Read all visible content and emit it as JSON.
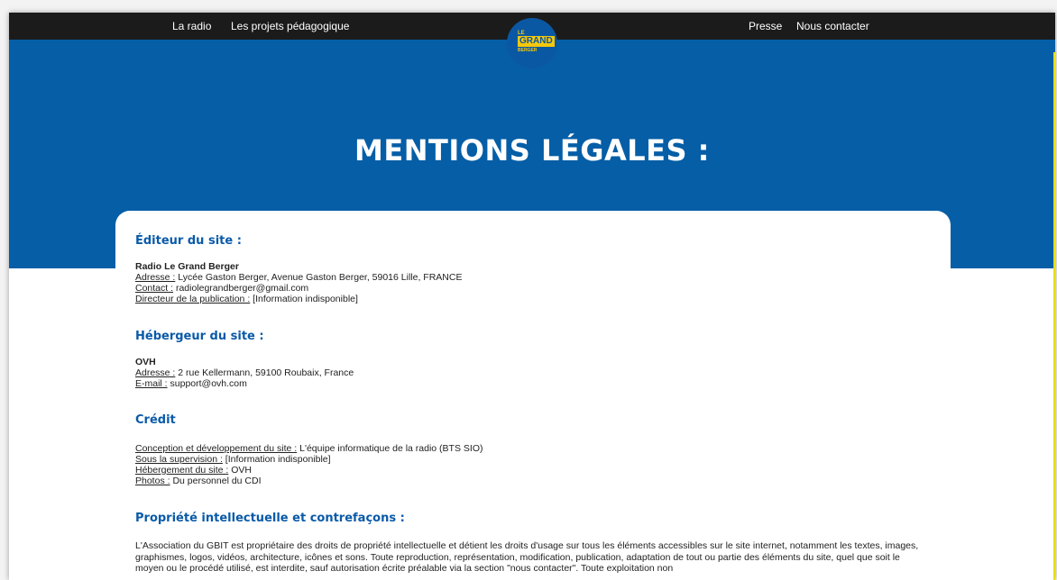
{
  "nav": {
    "left": [
      "La radio",
      "Les projets pédagogique"
    ],
    "right": [
      "Presse",
      "Nous contacter"
    ]
  },
  "logo": {
    "top": "LE",
    "main": "GRAND",
    "bottom": "BERGER",
    "colors": {
      "circle": "#0a58a3",
      "accent": "#f6c80b"
    }
  },
  "hero": {
    "title": "MENTIONS LÉGALES :",
    "background": "#055ea6"
  },
  "sections": {
    "editeur": {
      "title": "Éditeur du site :",
      "name": "Radio Le Grand Berger",
      "rows": [
        {
          "label": "Adresse :",
          "value": " Lycée Gaston Berger, Avenue Gaston Berger, 59016 Lille, FRANCE"
        },
        {
          "label": "Contact :",
          "value": " radiolegrandberger@gmail.com"
        },
        {
          "label": "Directeur de la publication :",
          "value": " [Information indisponible]"
        }
      ]
    },
    "hebergeur": {
      "title": "Hébergeur du site :",
      "name": "OVH",
      "rows": [
        {
          "label": "Adresse :",
          "value": " 2 rue Kellermann, 59100 Roubaix, France"
        },
        {
          "label": "E-mail :",
          "value": " support@ovh.com"
        }
      ]
    },
    "credit": {
      "title": "Crédit",
      "rows": [
        {
          "label": "Conception et développement du site :",
          "value": " L'équipe informatique de la radio (BTS SIO)"
        },
        {
          "label": "Sous la supervision :",
          "value": " [Information indisponible]"
        },
        {
          "label": "Hébergement du site :",
          "value": " OVH"
        },
        {
          "label": "Photos :",
          "value": " Du personnel du CDI"
        }
      ]
    },
    "propriete": {
      "title": "Propriété intellectuelle et contrefaçons :",
      "paragraph": "L'Association du GBIT est propriétaire des droits de propriété intellectuelle et détient les droits d'usage sur tous les éléments accessibles sur le site internet, notamment les textes, images, graphismes, logos, vidéos, architecture, icônes et sons. Toute reproduction, représentation, modification, publication, adaptation de tout ou partie des éléments du site, quel que soit le moyen ou le procédé utilisé, est interdite, sauf autorisation écrite préalable via la section \"nous contacter\". Toute exploitation non"
    }
  }
}
